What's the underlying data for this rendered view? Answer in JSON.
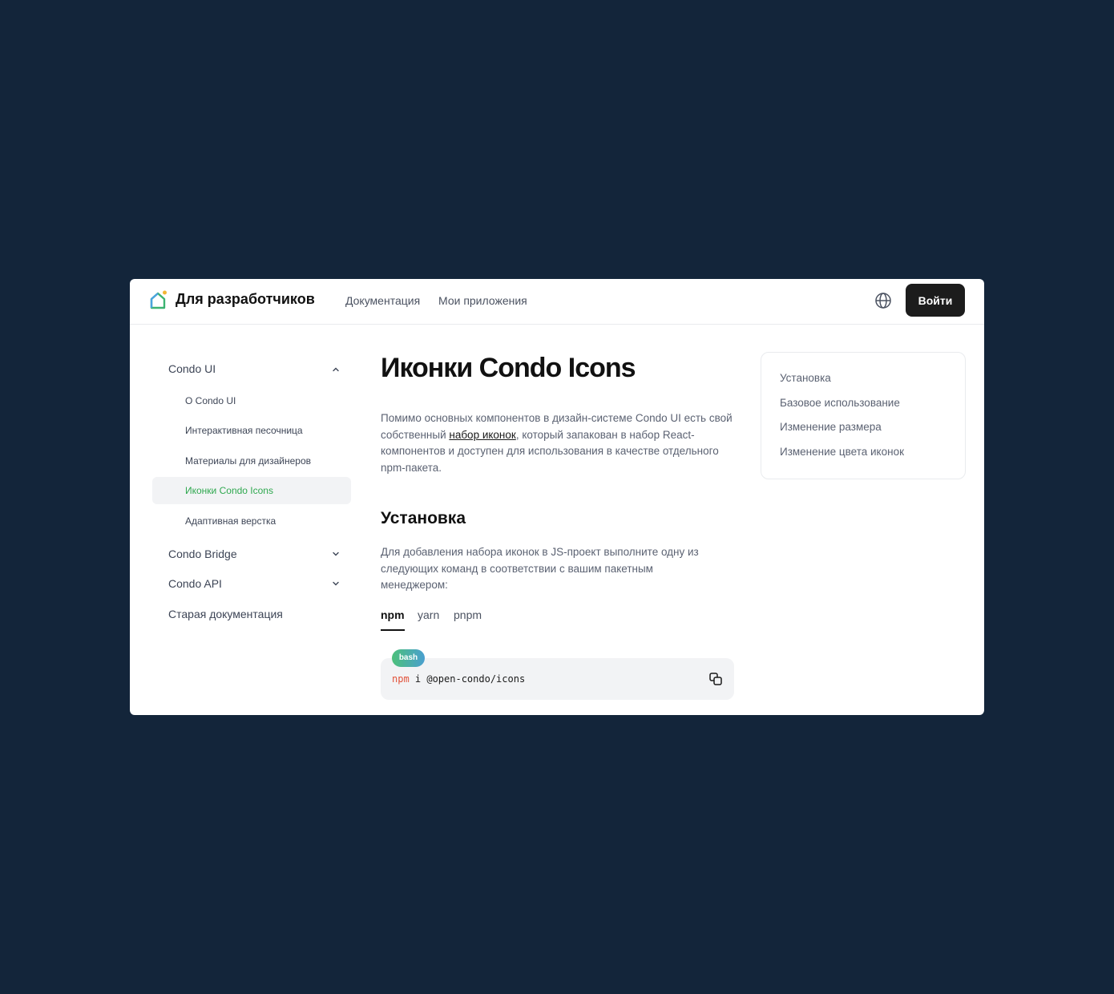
{
  "header": {
    "brand": "Для разработчиков",
    "nav": [
      "Документация",
      "Мои приложения"
    ],
    "login_label": "Войти"
  },
  "sidebar": {
    "groups": [
      {
        "label": "Condo UI",
        "expanded": true
      },
      {
        "label": "Condo Bridge",
        "expanded": false
      },
      {
        "label": "Condo API",
        "expanded": false
      },
      {
        "label": "Старая документация"
      }
    ],
    "items": [
      {
        "label": "О Condo UI",
        "active": false
      },
      {
        "label": "Интерактивная песочница",
        "active": false
      },
      {
        "label": "Материалы для дизайнеров",
        "active": false
      },
      {
        "label": "Иконки Condo Icons",
        "active": true
      },
      {
        "label": "Адаптивная верстка",
        "active": false
      }
    ]
  },
  "main": {
    "title": "Иконки Condo Icons",
    "intro": {
      "before": "Помимо основных компонентов в дизайн-системе Condo UI есть свой собственный ",
      "link": "набор иконок",
      "after": ", который запакован в набор React-компонентов и доступен для использования в качестве отдельного npm-пакета."
    },
    "install_heading": "Установка",
    "install_text": "Для добавления набора иконок в JS-проект выполните одну из следующих команд в соответствии с вашим пакетным менеджером:",
    "tabs": [
      "npm",
      "yarn",
      "pnpm"
    ],
    "active_tab": "npm",
    "code": {
      "language": "bash",
      "command": "npm",
      "args": " i @open-condo/icons"
    }
  },
  "toc": [
    "Установка",
    "Базовое использование",
    "Изменение размера",
    "Изменение цвета иконок"
  ],
  "colors": {
    "background": "#13253a",
    "accent_green": "#2fa84f",
    "button_dark": "#1c1c1c",
    "code_keyword": "#e2523a"
  },
  "icons": [
    "house-logo-icon",
    "globe-icon",
    "chevron-up-icon",
    "chevron-down-icon",
    "copy-icon"
  ]
}
